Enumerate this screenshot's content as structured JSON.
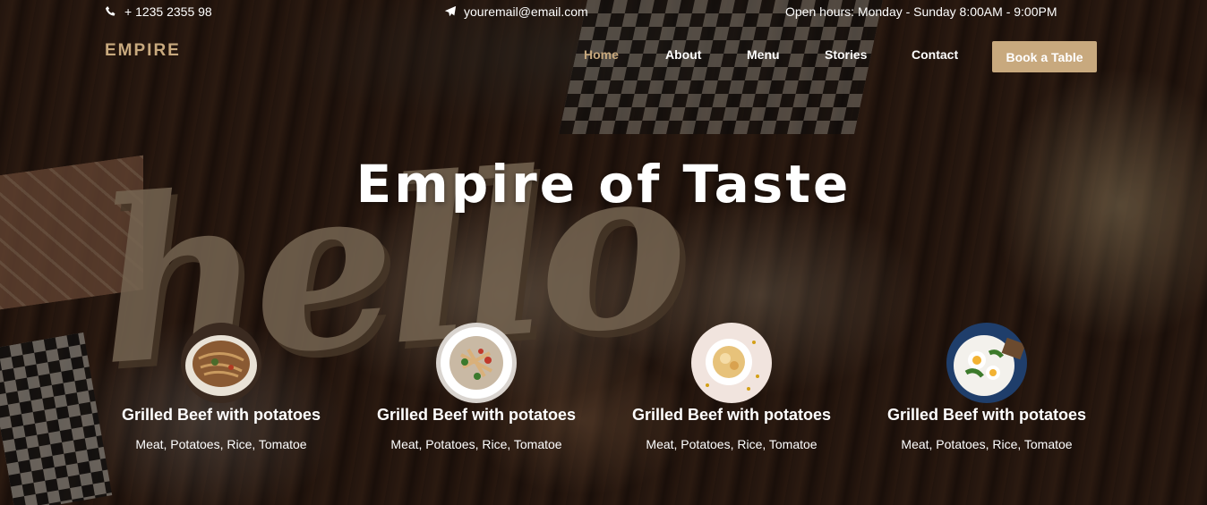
{
  "topbar": {
    "phone": "+ 1235 2355 98",
    "email": "youremail@email.com",
    "hours": "Open hours: Monday - Sunday 8:00AM - 9:00PM",
    "phone_icon": "phone-icon",
    "email_icon": "paper-plane-icon"
  },
  "brand": {
    "name": "EMPIRE",
    "color": "#c8a97e"
  },
  "nav": {
    "items": [
      {
        "label": "Home",
        "active": true
      },
      {
        "label": "About"
      },
      {
        "label": "Menu"
      },
      {
        "label": "Stories"
      },
      {
        "label": "Contact"
      }
    ],
    "cta": "Book a Table"
  },
  "hero": {
    "title": "Empire of Taste"
  },
  "dishes": [
    {
      "name": "Grilled Beef with potatoes",
      "ingredients": "Meat, Potatoes, Rice, Tomatoe"
    },
    {
      "name": "Grilled Beef with potatoes",
      "ingredients": "Meat, Potatoes, Rice, Tomatoe"
    },
    {
      "name": "Grilled Beef with potatoes",
      "ingredients": "Meat, Potatoes, Rice, Tomatoe"
    },
    {
      "name": "Grilled Beef with potatoes",
      "ingredients": "Meat, Potatoes, Rice, Tomatoe"
    }
  ],
  "colors": {
    "accent": "#c8a97e",
    "text": "#ffffff"
  }
}
